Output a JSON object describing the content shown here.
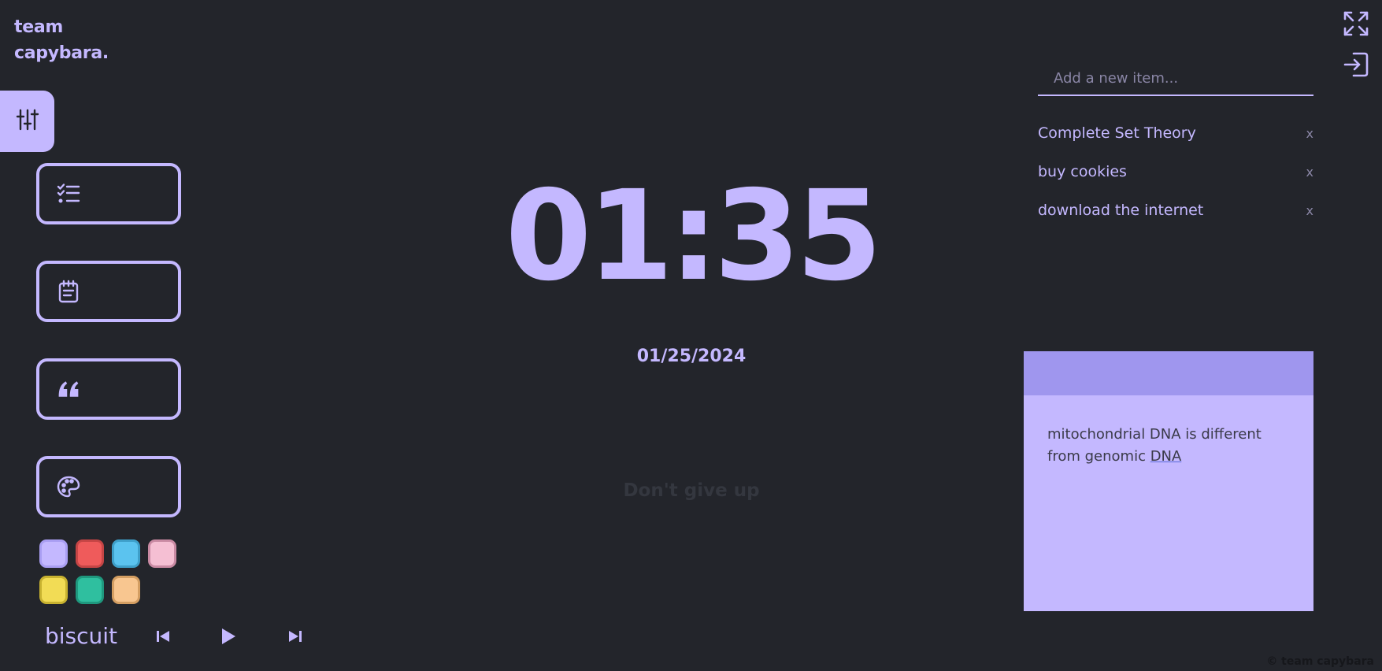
{
  "brand": {
    "line1": "team",
    "line2": "capybara."
  },
  "clock": {
    "time": "01:35",
    "date": "01/25/2024"
  },
  "quote": "Don't give up",
  "todo": {
    "placeholder": "Add a new item...",
    "remove_label": "x",
    "items": [
      {
        "text": "Complete Set Theory"
      },
      {
        "text": "buy cookies"
      },
      {
        "text": "download the internet"
      }
    ]
  },
  "note": {
    "text_before": "mitochondrial DNA is different from genomic ",
    "text_underlined": "DNA"
  },
  "music": {
    "track": "biscuit"
  },
  "sidebar": {
    "buttons": [
      {
        "icon": "checklist-icon"
      },
      {
        "icon": "notepad-icon"
      },
      {
        "icon": "quote-icon"
      },
      {
        "icon": "palette-icon"
      }
    ]
  },
  "swatches": [
    {
      "color": "#c4b8ff",
      "border": "#a99ef2"
    },
    {
      "color": "#ef5b5b",
      "border": "#c54545"
    },
    {
      "color": "#5bc3ef",
      "border": "#3e9fc9"
    },
    {
      "color": "#f5bfd3",
      "border": "#c98aa3"
    },
    {
      "color": "#f2dc55",
      "border": "#c8b230"
    },
    {
      "color": "#2fbf9f",
      "border": "#1f987e"
    },
    {
      "color": "#f8c690",
      "border": "#d49e62"
    }
  ],
  "copyright": "© team capybara",
  "colors": {
    "background": "#23252b",
    "accent": "#c4b8ff",
    "note_header": "#9f96ee"
  }
}
